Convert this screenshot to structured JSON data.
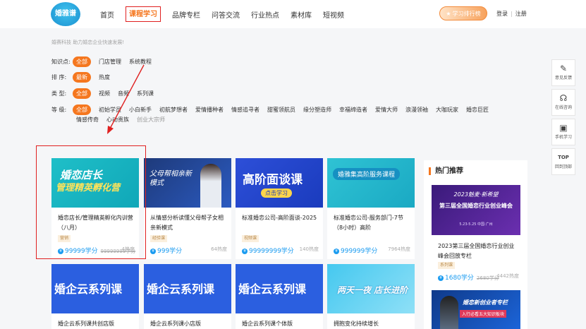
{
  "header": {
    "logo_text": "婚雅谱",
    "nav": [
      "首页",
      "课程学习",
      "品牌专栏",
      "问答交流",
      "行业热点",
      "素材库",
      "短视频"
    ],
    "active_nav": "课程学习",
    "rank_label": "学习排行榜",
    "login": "登录",
    "register": "注册",
    "accent": "#f5771f"
  },
  "filters": {
    "slogan": "婚赛科技 助力婚恋企业快速发展!",
    "knowledge": {
      "label": "知识点:",
      "options": [
        "全部",
        "门店管理",
        "系统教程"
      ]
    },
    "sort": {
      "label": "排  序:",
      "options": [
        "最新",
        "热度"
      ]
    },
    "type": {
      "label": "类  型:",
      "options": [
        "全部",
        "视频",
        "音频",
        "系列课"
      ]
    },
    "level": {
      "label": "等  级:",
      "options": [
        "全部",
        "初始学员",
        "小白新手",
        "初航梦想者",
        "爱情播种者",
        "情感追寻者",
        "甜蜜领航员",
        "缘分塑造师",
        "幸福缔造者",
        "爱情大师",
        "浪漫领袖",
        "大咖玩家",
        "婚恋巨匠"
      ],
      "options_row2": [
        "情感传奇",
        "心动贵族",
        "创业大宗师"
      ]
    }
  },
  "courses": [
    {
      "title": "婚恋店长/管理精英孵化内训营（八月）",
      "tag": "营销",
      "price": "99999学分",
      "old_price": "99999999学分",
      "heat": "4热度",
      "thumb_main": "婚恋店长",
      "thumb_sub": "管理精英孵化营"
    },
    {
      "title": "从情感分析读懂父母帮子女相亲新模式",
      "tag": "经验课",
      "price": "999学分",
      "heat": "64热度",
      "thumb_main": "父母帮相亲新模式"
    },
    {
      "title": "标准婚恋公司-高阶面谈-2025",
      "tag": "视频课",
      "price": "99999999学分",
      "heat": "140热度",
      "thumb_main": "高阶面谈课",
      "thumb_sub": "点击学习"
    },
    {
      "title": "标准婚恋公司-服务部门-7节（8小时）高阶",
      "price": "999999学分",
      "heat": "7964热度",
      "thumb_main": "婚雅集高阶服务课程"
    },
    {
      "title": "婚企云系列课共创店版",
      "thumb_main": "婚企云系列课"
    },
    {
      "title": "婚企云系列课小店版",
      "thumb_main": "婚企云系列课"
    },
    {
      "title": "婚企云系列课个体版",
      "thumb_main": "婚企云系列课"
    },
    {
      "title": "拥抱变化持续增长",
      "thumb_main": "两天一夜 店长进阶"
    }
  ],
  "hot": {
    "title": "热门推荐",
    "items": [
      {
        "title": "2023第三届全国婚恋行业创业峰会回放专栏",
        "tag": "系列课",
        "price": "1680学分",
        "old_price": "2680学分",
        "heat": "4442热度",
        "banner_top": "2023魅麦·新希望",
        "banner_main": "第三届全国婚恋行业创业峰会",
        "banner_date": "5.23-5.25 中国·广州"
      },
      {
        "banner_main": "婚恋新创业者专栏",
        "banner_sub": "入行必看五大知识板块"
      }
    ]
  },
  "right_tools": [
    "意见反馈",
    "在线咨询",
    "手机学习",
    "回到顶部"
  ],
  "right_tool_top": "TOP"
}
